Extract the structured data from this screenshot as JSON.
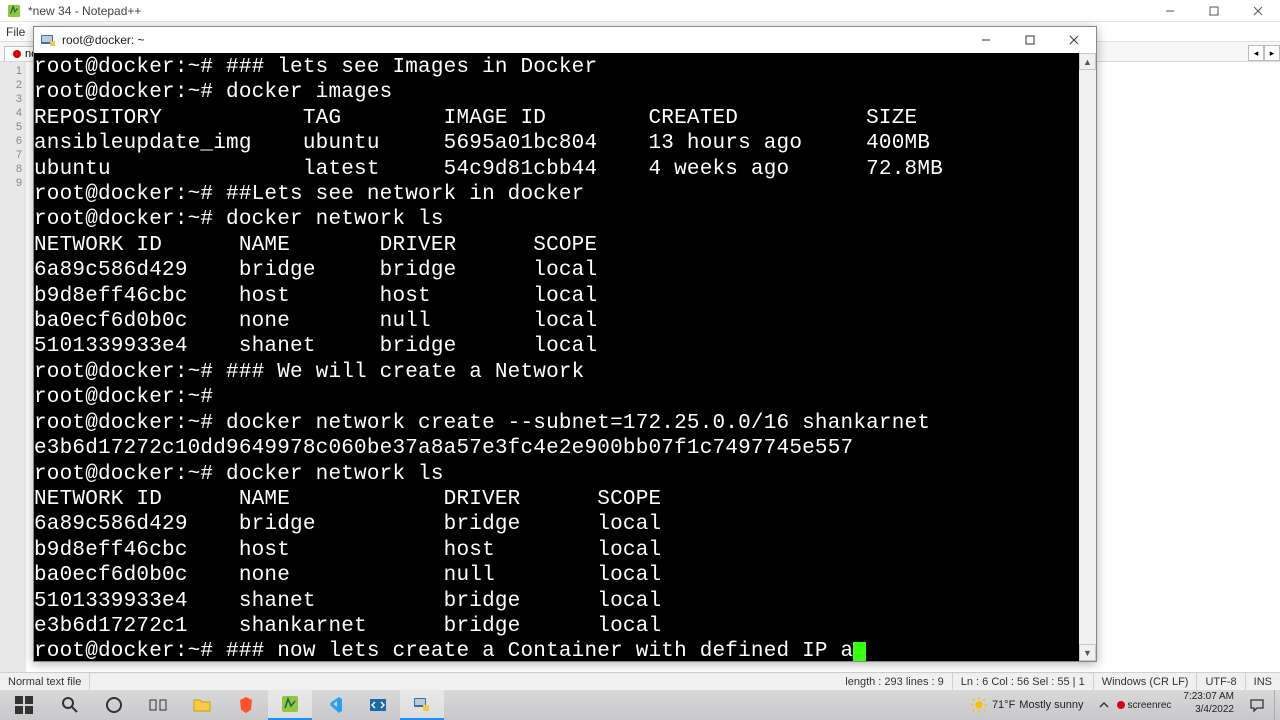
{
  "notepad_pp": {
    "title": "*new 34 - Notepad++",
    "menu_first": "File",
    "tab_label": "ne",
    "gutter_lines": [
      "1",
      "2",
      "3",
      "4",
      "5",
      "6",
      "7",
      "8",
      "9"
    ],
    "status": {
      "file_type": "Normal text file",
      "length_lines": "length : 293    lines : 9",
      "pos": "Ln : 6    Col : 56    Sel : 55 | 1",
      "eol": "Windows (CR LF)",
      "encoding": "UTF-8",
      "mode": "INS"
    }
  },
  "terminal": {
    "title": "root@docker: ~",
    "lines": [
      "root@docker:~# ### lets see Images in Docker",
      "root@docker:~# docker images",
      "REPOSITORY           TAG        IMAGE ID        CREATED          SIZE",
      "ansibleupdate_img    ubuntu     5695a01bc804    13 hours ago     400MB",
      "ubuntu               latest     54c9d81cbb44    4 weeks ago      72.8MB",
      "root@docker:~# ##Lets see network in docker",
      "root@docker:~# docker network ls",
      "NETWORK ID      NAME       DRIVER      SCOPE",
      "6a89c586d429    bridge     bridge      local",
      "b9d8eff46cbc    host       host        local",
      "ba0ecf6d0b0c    none       null        local",
      "5101339933e4    shanet     bridge      local",
      "root@docker:~# ### We will create a Network",
      "root@docker:~#",
      "root@docker:~# docker network create --subnet=172.25.0.0/16 shankarnet",
      "e3b6d17272c10dd9649978c060be37a8a57e3fc4e2e900bb07f1c7497745e557",
      "root@docker:~# docker network ls",
      "NETWORK ID      NAME            DRIVER      SCOPE",
      "6a89c586d429    bridge          bridge      local",
      "b9d8eff46cbc    host            host        local",
      "ba0ecf6d0b0c    none            null        local",
      "5101339933e4    shanet          bridge      local",
      "e3b6d17272c1    shankarnet      bridge      local"
    ],
    "last_line_prefix": "root@docker:~# ### now lets create a Container with defined IP a"
  },
  "taskbar": {
    "weather_temp": "71°F",
    "weather_desc": "Mostly sunny",
    "screenrec": "screenrec",
    "time": "7:23:07 AM",
    "date": "3/4/2022"
  },
  "icons": {
    "npp_app": "notepad-pp-icon",
    "putty_app": "putty-icon",
    "windows_start": "windows-logo-icon"
  }
}
